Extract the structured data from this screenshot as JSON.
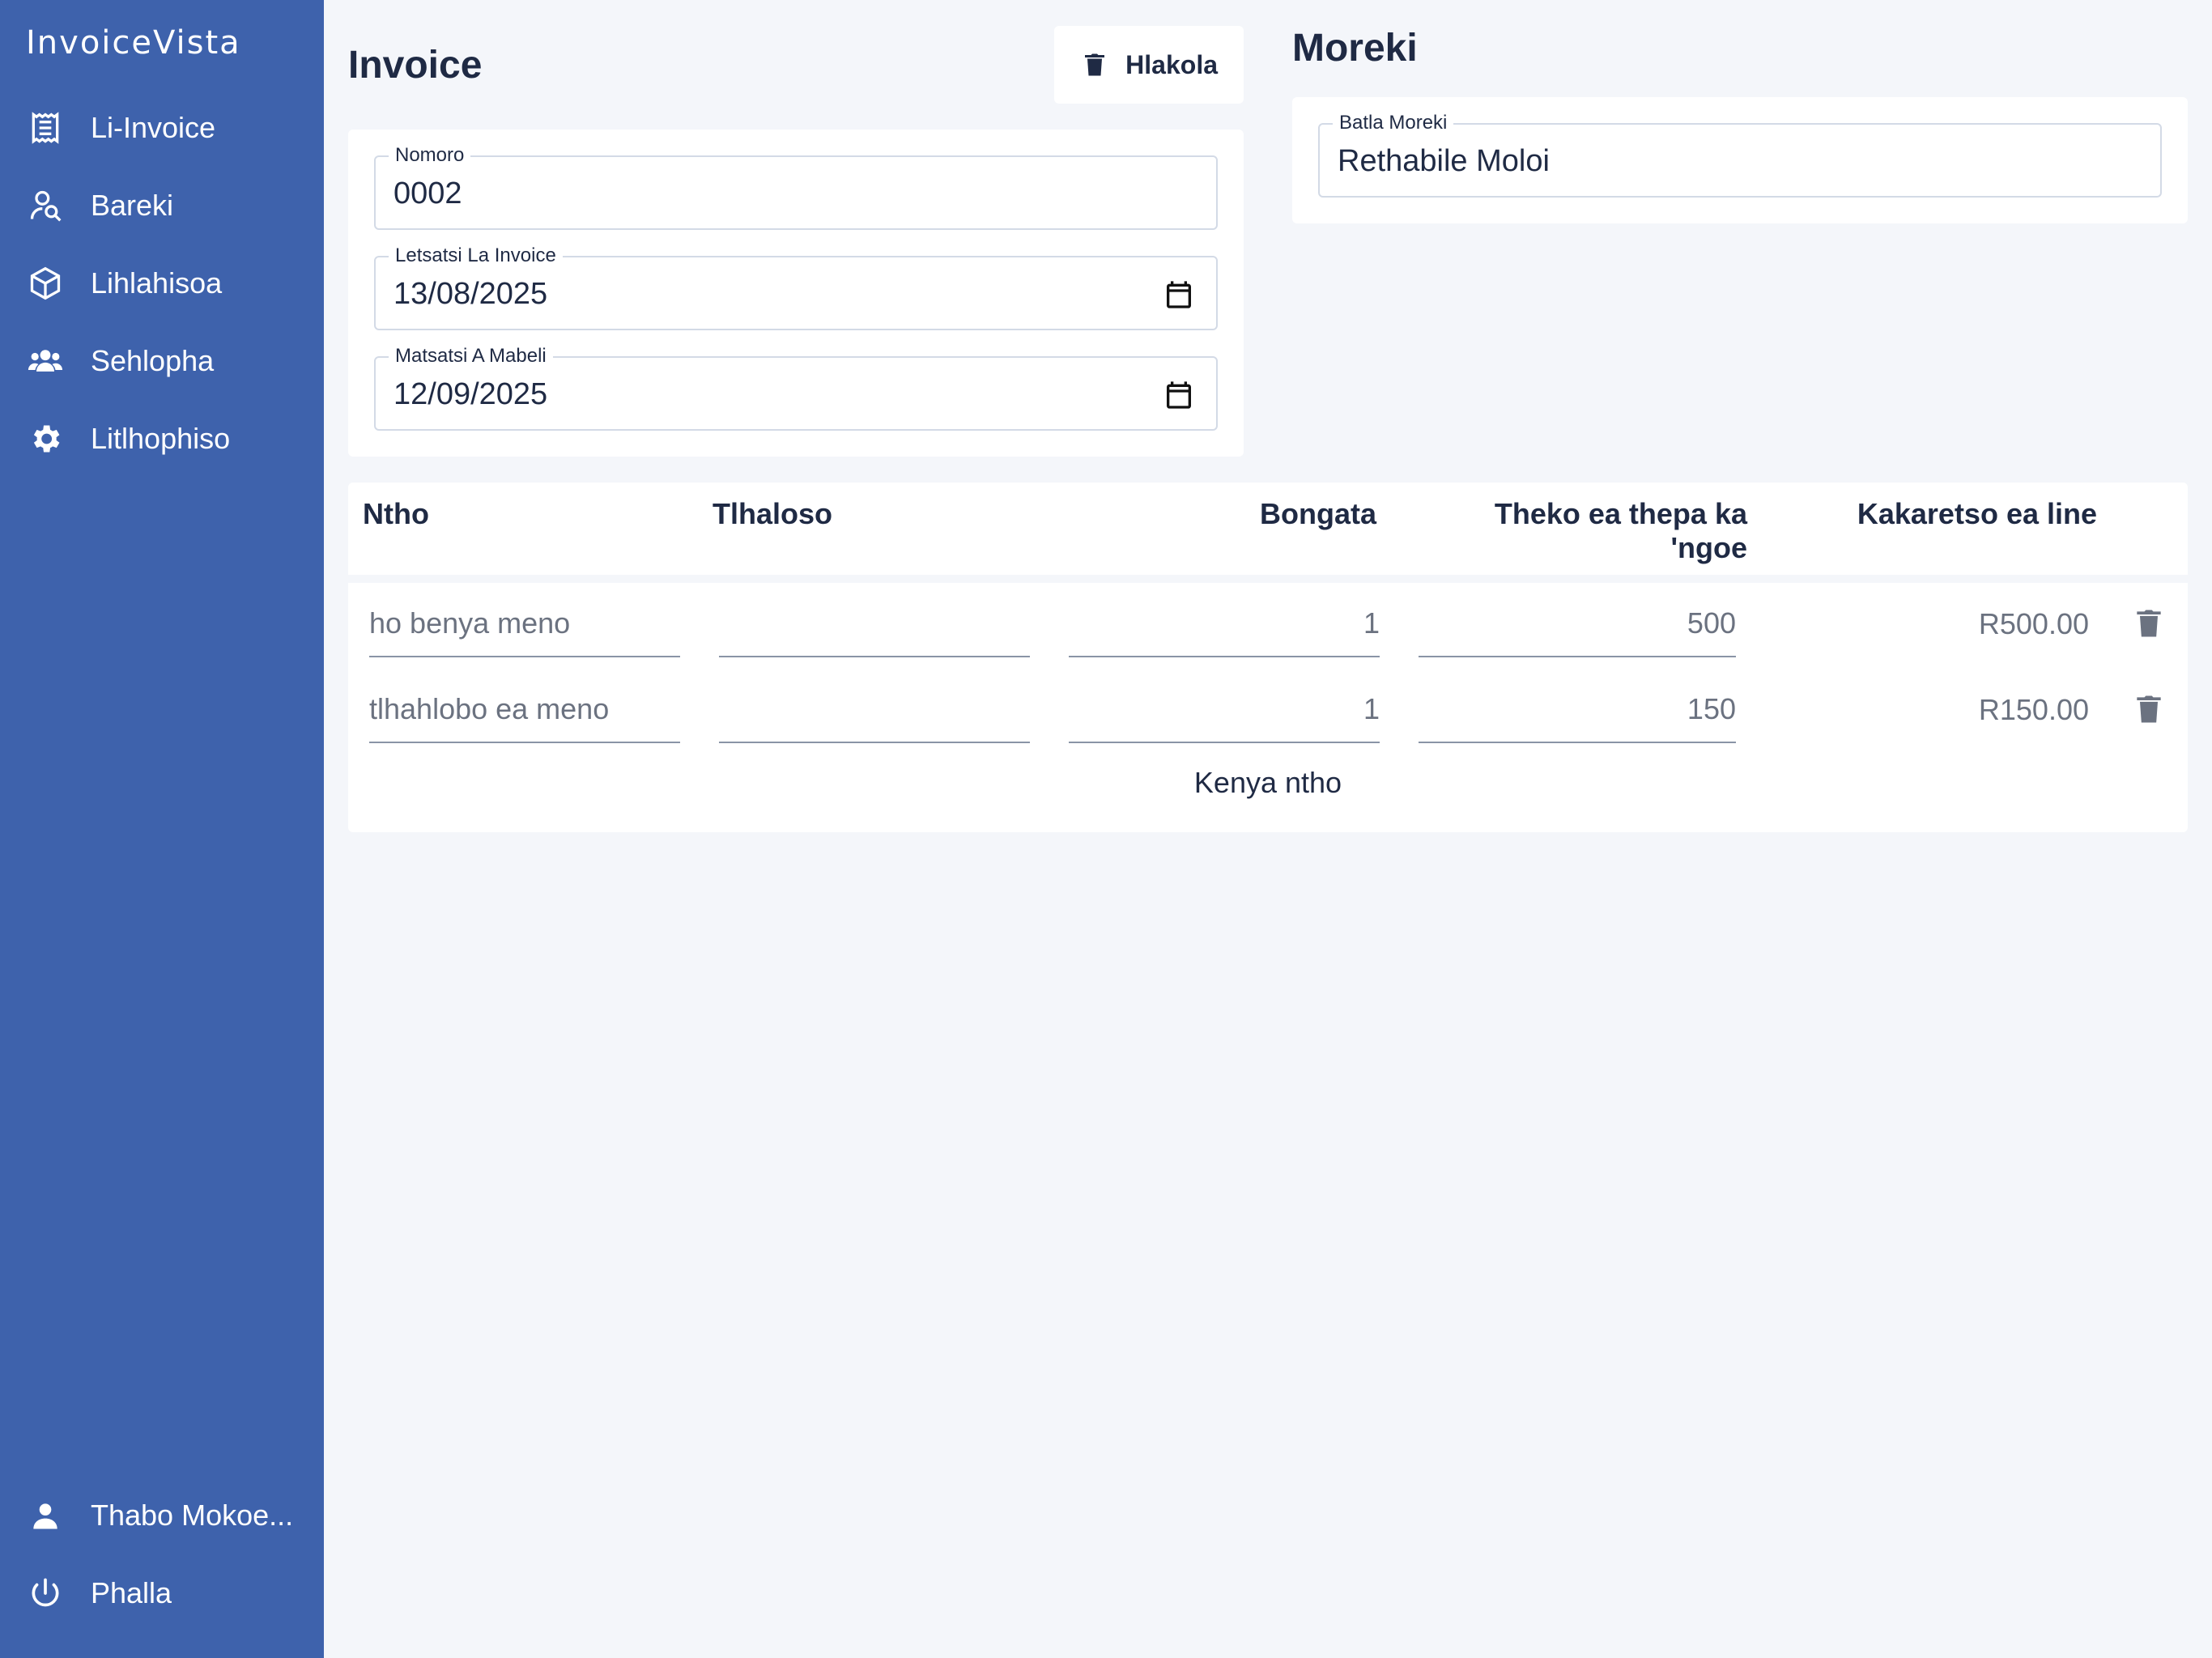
{
  "sidebar": {
    "brand": "InvoiceVista",
    "items": [
      {
        "label": "Li-Invoice",
        "icon": "receipt-icon"
      },
      {
        "label": "Bareki",
        "icon": "customer-search-icon"
      },
      {
        "label": "Lihlahisoa",
        "icon": "box-icon"
      },
      {
        "label": "Sehlopha",
        "icon": "group-icon"
      },
      {
        "label": "Litlhophiso",
        "icon": "gear-icon"
      }
    ],
    "user": {
      "label": "Thabo Mokoe...",
      "icon": "user-icon"
    },
    "logout": {
      "label": "Phalla",
      "icon": "power-icon"
    }
  },
  "invoice": {
    "title": "Invoice",
    "delete_label": "Hlakola",
    "fields": {
      "number": {
        "label": "Nomoro",
        "value": "0002"
      },
      "invoice_date": {
        "label": "Letsatsi La Invoice",
        "value": "13/08/2025"
      },
      "due_date": {
        "label": "Matsatsi A Mabeli",
        "value": "12/09/2025"
      }
    }
  },
  "customer": {
    "title": "Moreki",
    "search": {
      "label": "Batla Moreki",
      "value": "Rethabile Moloi"
    }
  },
  "items": {
    "columns": {
      "item": "Ntho",
      "description": "Tlhaloso",
      "quantity": "Bongata",
      "unit_price_line1": "Theko ea thepa ka",
      "unit_price_line2": "'ngoe",
      "line_total": "Kakaretso ea line"
    },
    "rows": [
      {
        "item": "ho benya meno",
        "description": "",
        "quantity": "1",
        "unit_price": "500",
        "line_total": "R500.00"
      },
      {
        "item": "tlhahlobo ea meno",
        "description": "",
        "quantity": "1",
        "unit_price": "150",
        "line_total": "R150.00"
      }
    ],
    "add_label": "Kenya ntho"
  },
  "colors": {
    "sidebar": "#3e62ac",
    "background": "#f4f6fa",
    "text": "#1f2a44",
    "muted": "#6b7280"
  }
}
